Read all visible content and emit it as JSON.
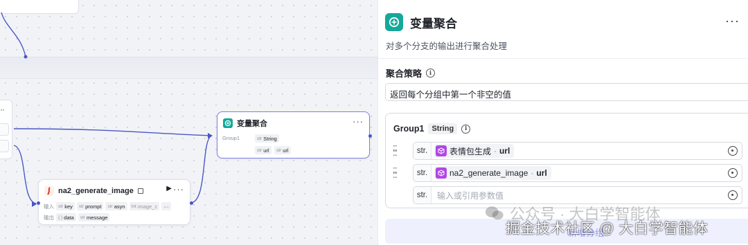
{
  "canvas": {
    "agg_node": {
      "title": "变量聚合",
      "group_label": "Group1",
      "type_tag": "str",
      "type_value": "String",
      "var_tag": "str",
      "var_value": "url",
      "var2_tag": "str",
      "var2_value": "url"
    },
    "gen_node": {
      "title": "na2_generate_image",
      "input_label": "输入",
      "output_label": "输出",
      "inputs": [
        {
          "tag": "str",
          "name": "key"
        },
        {
          "tag": "str",
          "name": "prompt"
        },
        {
          "tag": "str",
          "name": "asyn"
        },
        {
          "tag": "Int",
          "name": "image_c"
        }
      ],
      "outputs": [
        {
          "tag": "{ }",
          "name": "data"
        },
        {
          "tag": "str",
          "name": "message"
        }
      ]
    }
  },
  "panel": {
    "title": "变量聚合",
    "description": "对多个分支的输出进行聚合处理",
    "strategy_label": "聚合策略",
    "strategy_value": "返回每个分组中第一个非空的值",
    "group": {
      "name": "Group1",
      "type": "String",
      "rows": [
        {
          "type": "str.",
          "source": "表情包生成",
          "sep": "·",
          "field": "url"
        },
        {
          "type": "str.",
          "source": "na2_generate_image",
          "sep": "·",
          "field": "url"
        }
      ],
      "empty_row": {
        "type": "str.",
        "placeholder": "输入或引用参数值"
      }
    },
    "add_button": "新增分组"
  },
  "watermark": {
    "line1": "公众号 · 大白学智能体",
    "line2": "掘金技术社区 @ 大白学智能体"
  },
  "colors": {
    "accent": "#4d53e8",
    "teal_icon": "#14a89a",
    "purple_icon": "#b146e6",
    "edge": "#4a56c6"
  }
}
